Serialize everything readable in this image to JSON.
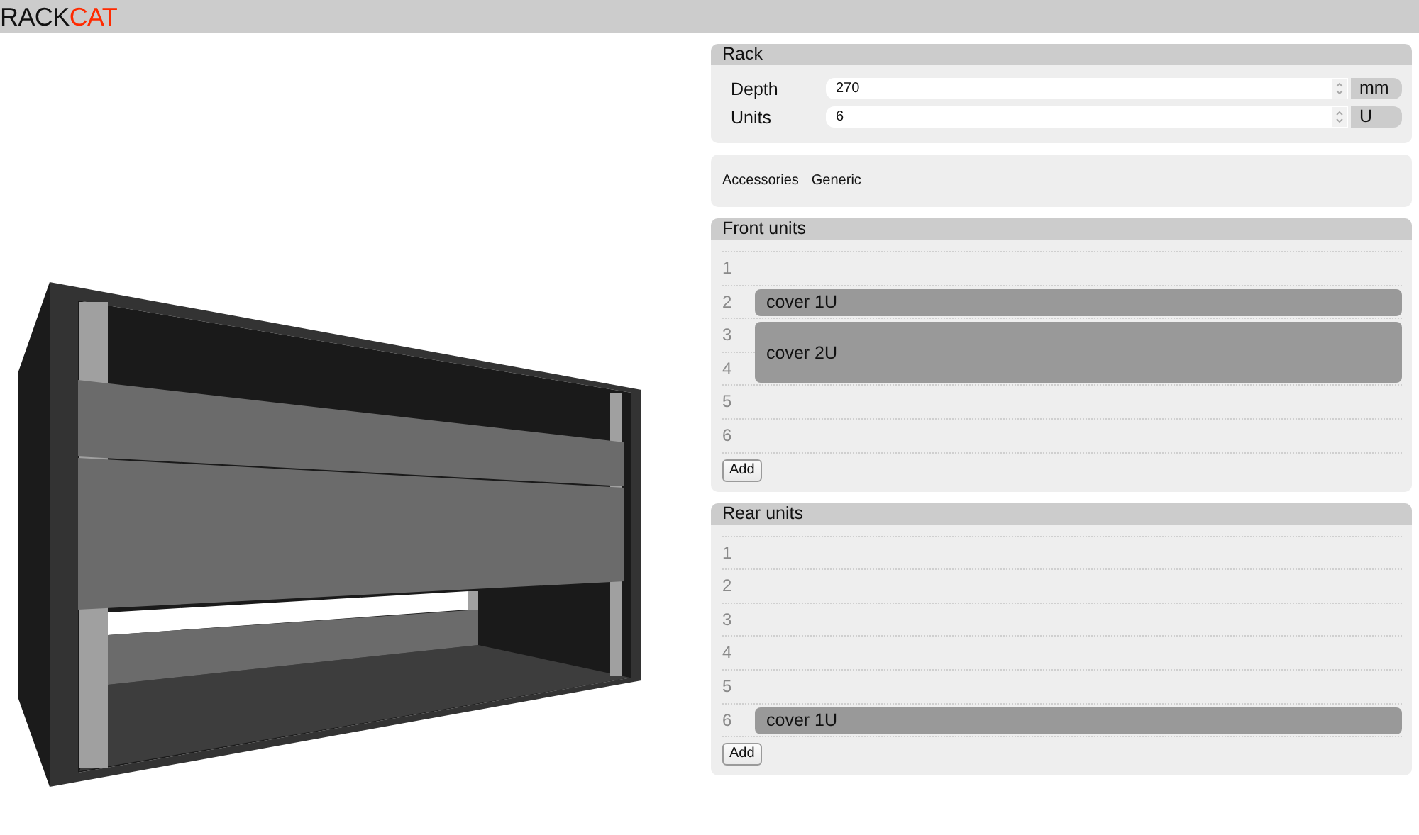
{
  "header": {
    "logo_text": "RACK",
    "logo_accent": "CAT"
  },
  "rack": {
    "title": "Rack",
    "fields": [
      {
        "label": "Depth",
        "value": "270",
        "unit": "mm"
      },
      {
        "label": "Units",
        "value": "6",
        "unit": "U"
      }
    ]
  },
  "accessories": {
    "items": [
      "Accessories",
      "Generic"
    ]
  },
  "front_units": {
    "title": "Front units",
    "rows": [
      {
        "slots": [
          "1"
        ]
      },
      {
        "slots": [
          "2"
        ],
        "unit": "cover 1U"
      },
      {
        "slots": [
          "3",
          "4"
        ],
        "unit": "cover 2U"
      },
      {
        "slots": [
          "5"
        ]
      },
      {
        "slots": [
          "6"
        ]
      }
    ],
    "add_button": "Add"
  },
  "rear_units": {
    "title": "Rear units",
    "rows": [
      {
        "slots": [
          "1"
        ]
      },
      {
        "slots": [
          "2"
        ]
      },
      {
        "slots": [
          "3"
        ]
      },
      {
        "slots": [
          "4"
        ]
      },
      {
        "slots": [
          "5"
        ]
      },
      {
        "slots": [
          "6"
        ],
        "unit": "cover 1U"
      }
    ],
    "add_button": "Add"
  }
}
